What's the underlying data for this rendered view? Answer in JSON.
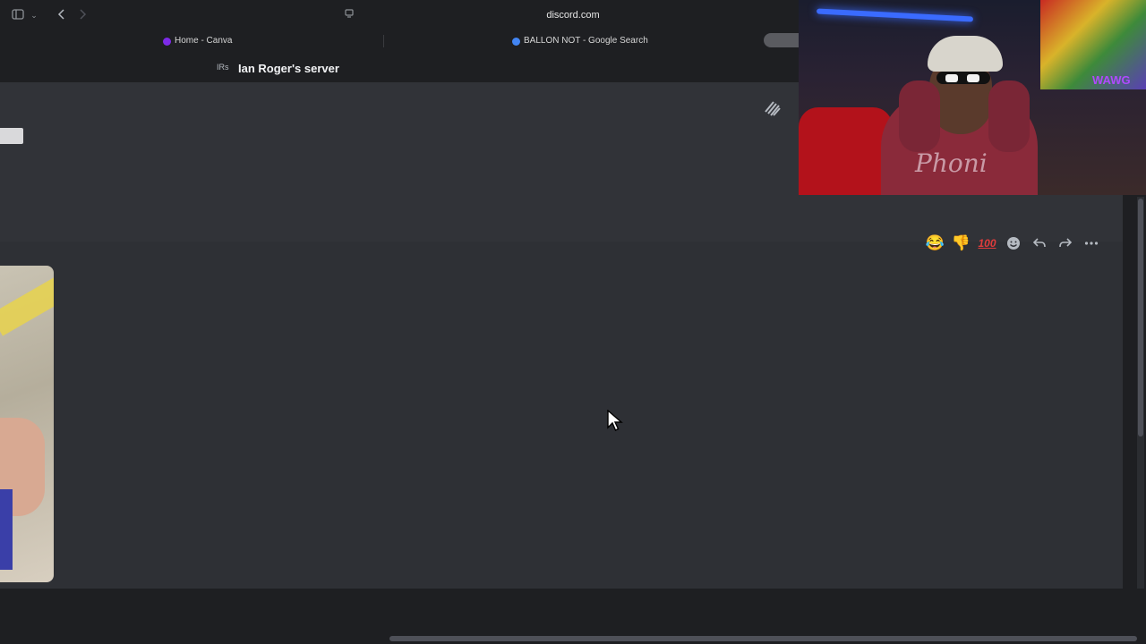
{
  "browser": {
    "url": "discord.com",
    "tabs": [
      {
        "label": "Home - Canva",
        "favicon_color": "#7d2ae8"
      },
      {
        "label": "BALLON NOT - Google Search",
        "favicon_color": "#4285f4"
      }
    ]
  },
  "server": {
    "abbreviation": "IRs",
    "name": "Ian Roger's server"
  },
  "message_toolbar": {
    "reactions": [
      {
        "emoji": "😂",
        "name": "joy-emoji"
      },
      {
        "emoji": "👎",
        "name": "thumbs-down-emoji"
      },
      {
        "emoji": "100",
        "name": "hundred-emoji"
      }
    ],
    "actions": [
      "add-reaction",
      "reply",
      "forward",
      "more"
    ]
  },
  "webcam": {
    "wall_art_text": "WAWG",
    "hoodie_text": "Phoni"
  },
  "colors": {
    "background": "#1e1f22",
    "content": "#313338",
    "accent_red": "#e03c3c"
  }
}
